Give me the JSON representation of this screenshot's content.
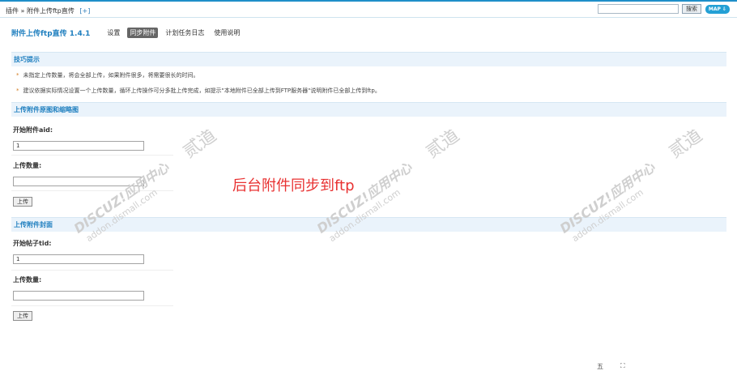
{
  "topbar": {
    "breadcrumb": "插件 » 附件上传ftp直传",
    "breadcrumb_plus": "[+]",
    "search_value": "",
    "search_button": "搜索",
    "map_button": "MAP ⇩"
  },
  "titlebar": {
    "plugin_title": "附件上传ftp直传 1.4.1",
    "tabs": [
      "设置",
      "同步附件",
      "计划任务日志",
      "使用说明"
    ],
    "active_tab": "同步附件"
  },
  "tips": {
    "header": "技巧提示",
    "items": [
      "未指定上传数量，将会全部上传，如果附件很多，将需要很长的时间。",
      "建议依据实际情况设置一个上传数量，循环上传操作可分多批上传完成，如提示\"本地附件已全部上传到FTP服务器\"说明附件已全部上传到ftp。"
    ]
  },
  "section1": {
    "header": "上传附件原图和缩略图",
    "aid_label": "开始附件aid:",
    "aid_value": "1",
    "count_label": "上传数量:",
    "count_value": "",
    "submit": "上传"
  },
  "section2": {
    "header": "上传附件封面",
    "tid_label": "开始帖子tid:",
    "tid_value": "1",
    "count_label": "上传数量:",
    "count_value": "",
    "submit": "上传"
  },
  "overlay_caption": "后台附件同步到ftp",
  "watermark": {
    "brand": "DISCUZ!应用中心",
    "domain": "addon.dismall.com",
    "mark": "贰道"
  },
  "corner": {
    "icon1": "五",
    "icon2": "⛶"
  }
}
